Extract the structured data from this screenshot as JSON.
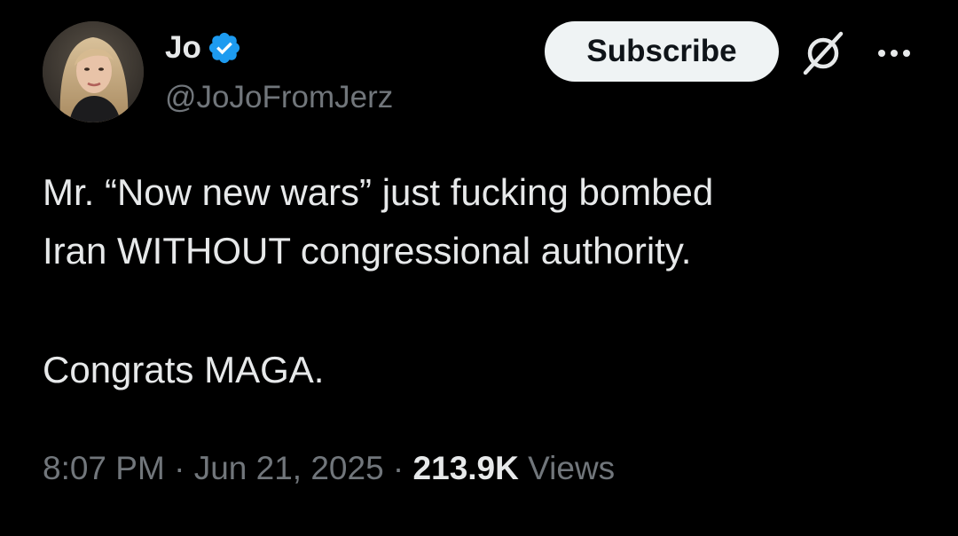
{
  "author": {
    "display_name": "Jo",
    "handle": "@JoJoFromJerz",
    "verified_icon": "verified-badge-icon",
    "verified_color": "#1d9bf0"
  },
  "header": {
    "subscribe_label": "Subscribe",
    "grok_icon": "grok-icon",
    "more_icon": "more-options-icon"
  },
  "tweet": {
    "line1": "Mr. “Now new wars” just fucking bombed",
    "line2": "Iran WITHOUT congressional authority.",
    "line3": "Congrats MAGA."
  },
  "meta": {
    "time": "8:07 PM",
    "sep1": " · ",
    "date": "Jun 21, 2025",
    "sep2": " · ",
    "views_count": "213.9K",
    "views_label": " Views"
  },
  "colors": {
    "background": "#000000",
    "text_primary": "#e7e9ea",
    "text_secondary": "#71767b",
    "button_bg": "#eff3f4"
  }
}
